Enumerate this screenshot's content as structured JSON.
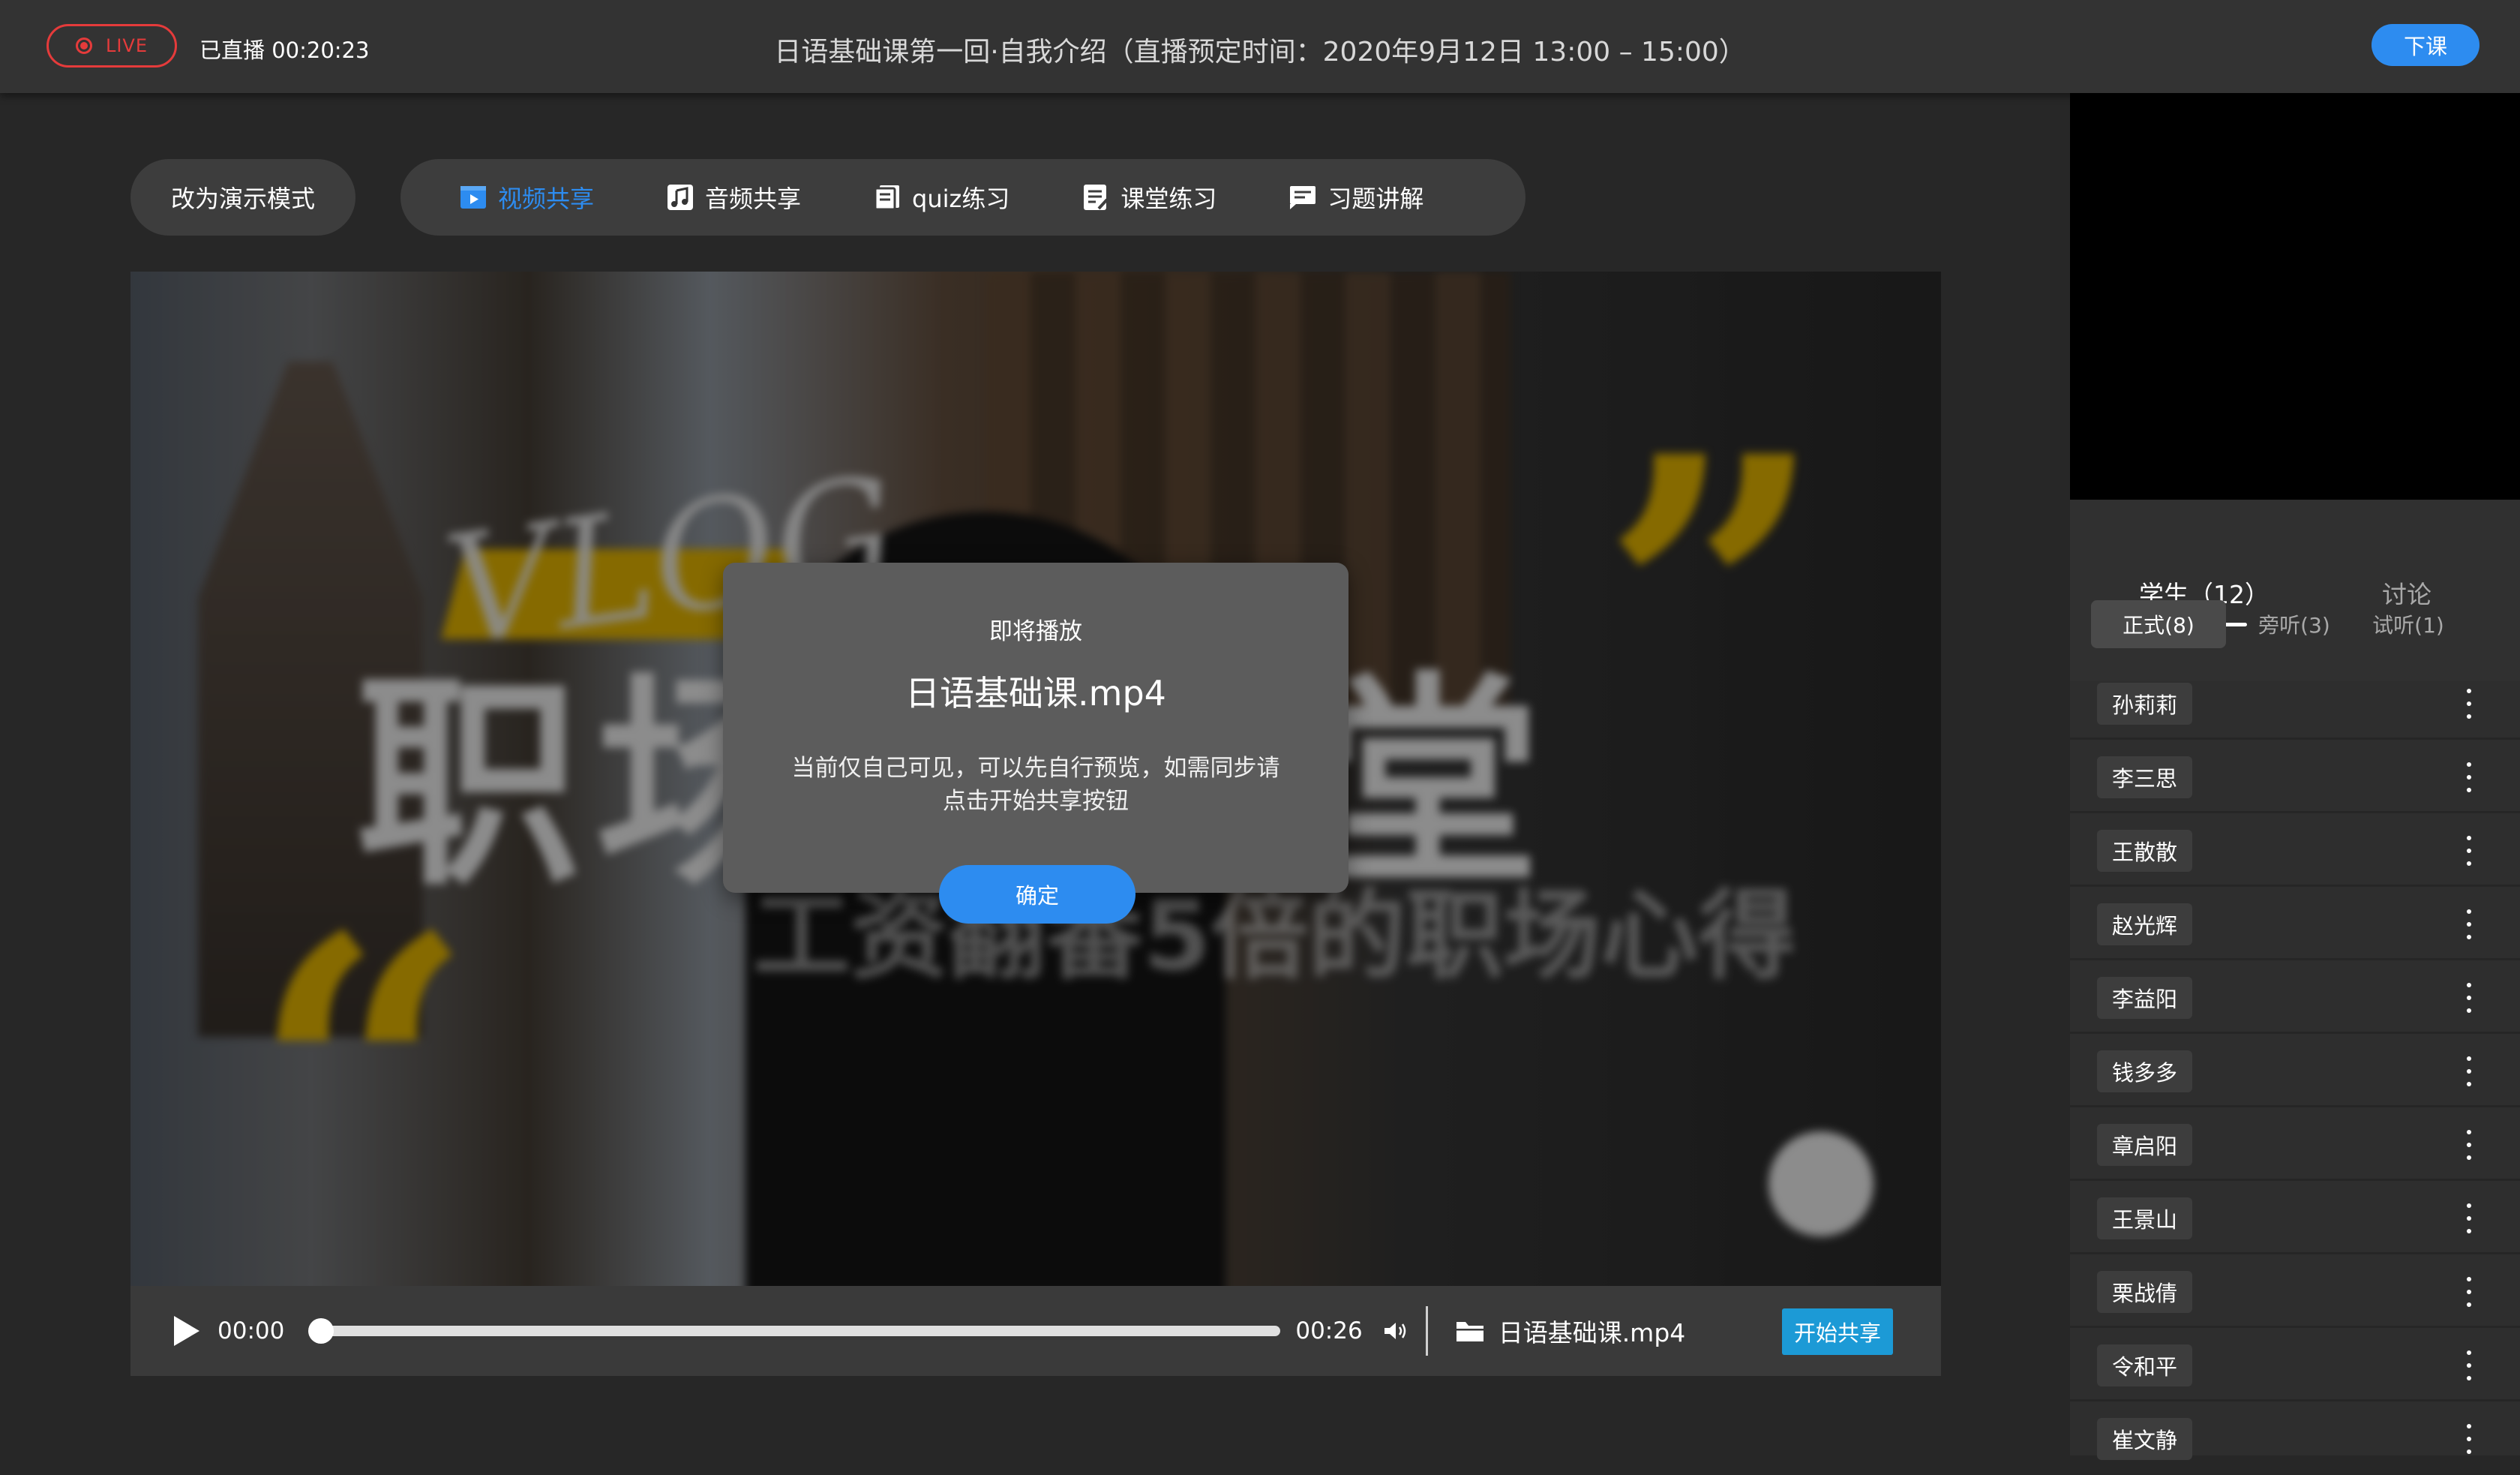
{
  "header": {
    "live_label": "LIVE",
    "elapsed": "已直播 00:20:23",
    "title": "日语基础课第一回·自我介绍（直播预定时间：2020年9月12日 13:00 – 15:00）",
    "end_button": "下课"
  },
  "toolbar": {
    "mode_button": "改为演示模式",
    "tools": [
      {
        "label": "视频共享",
        "icon": "video-share-icon",
        "active": true
      },
      {
        "label": "音频共享",
        "icon": "music-note-icon",
        "active": false
      },
      {
        "label": "quiz练习",
        "icon": "quiz-icon",
        "active": false
      },
      {
        "label": "课堂练习",
        "icon": "exercise-icon",
        "active": false
      },
      {
        "label": "习题讲解",
        "icon": "explain-icon",
        "active": false
      }
    ]
  },
  "video": {
    "thumbnail_text": {
      "vlog": "VLOG",
      "title": "职场微课堂",
      "subtitle": "工资翻番5倍的职场心得"
    },
    "current_time": "00:00",
    "duration": "00:26",
    "progress": 0,
    "file_name": "日语基础课.mp4",
    "share_button": "开始共享"
  },
  "modal": {
    "heading": "即将播放",
    "file_name": "日语基础课.mp4",
    "message": "当前仅自己可见，可以先自行预览，如需同步请点击开始共享按钮",
    "ok_button": "确定"
  },
  "sidebar": {
    "tabs": [
      "学生（12）",
      "讨论"
    ],
    "subtabs": [
      "正式(8)",
      "旁听(3)",
      "试听(1)"
    ],
    "students": [
      "孙莉莉",
      "李三思",
      "王散散",
      "赵光辉",
      "李益阳",
      "钱多多",
      "章启阳",
      "王景山",
      "栗战倩",
      "令和平",
      "崔文静"
    ]
  },
  "colors": {
    "accent": "#2d8cf0",
    "live_red": "#e53b3b",
    "share_blue": "#1c9ad6",
    "highlight_yellow": "#f5c200"
  }
}
